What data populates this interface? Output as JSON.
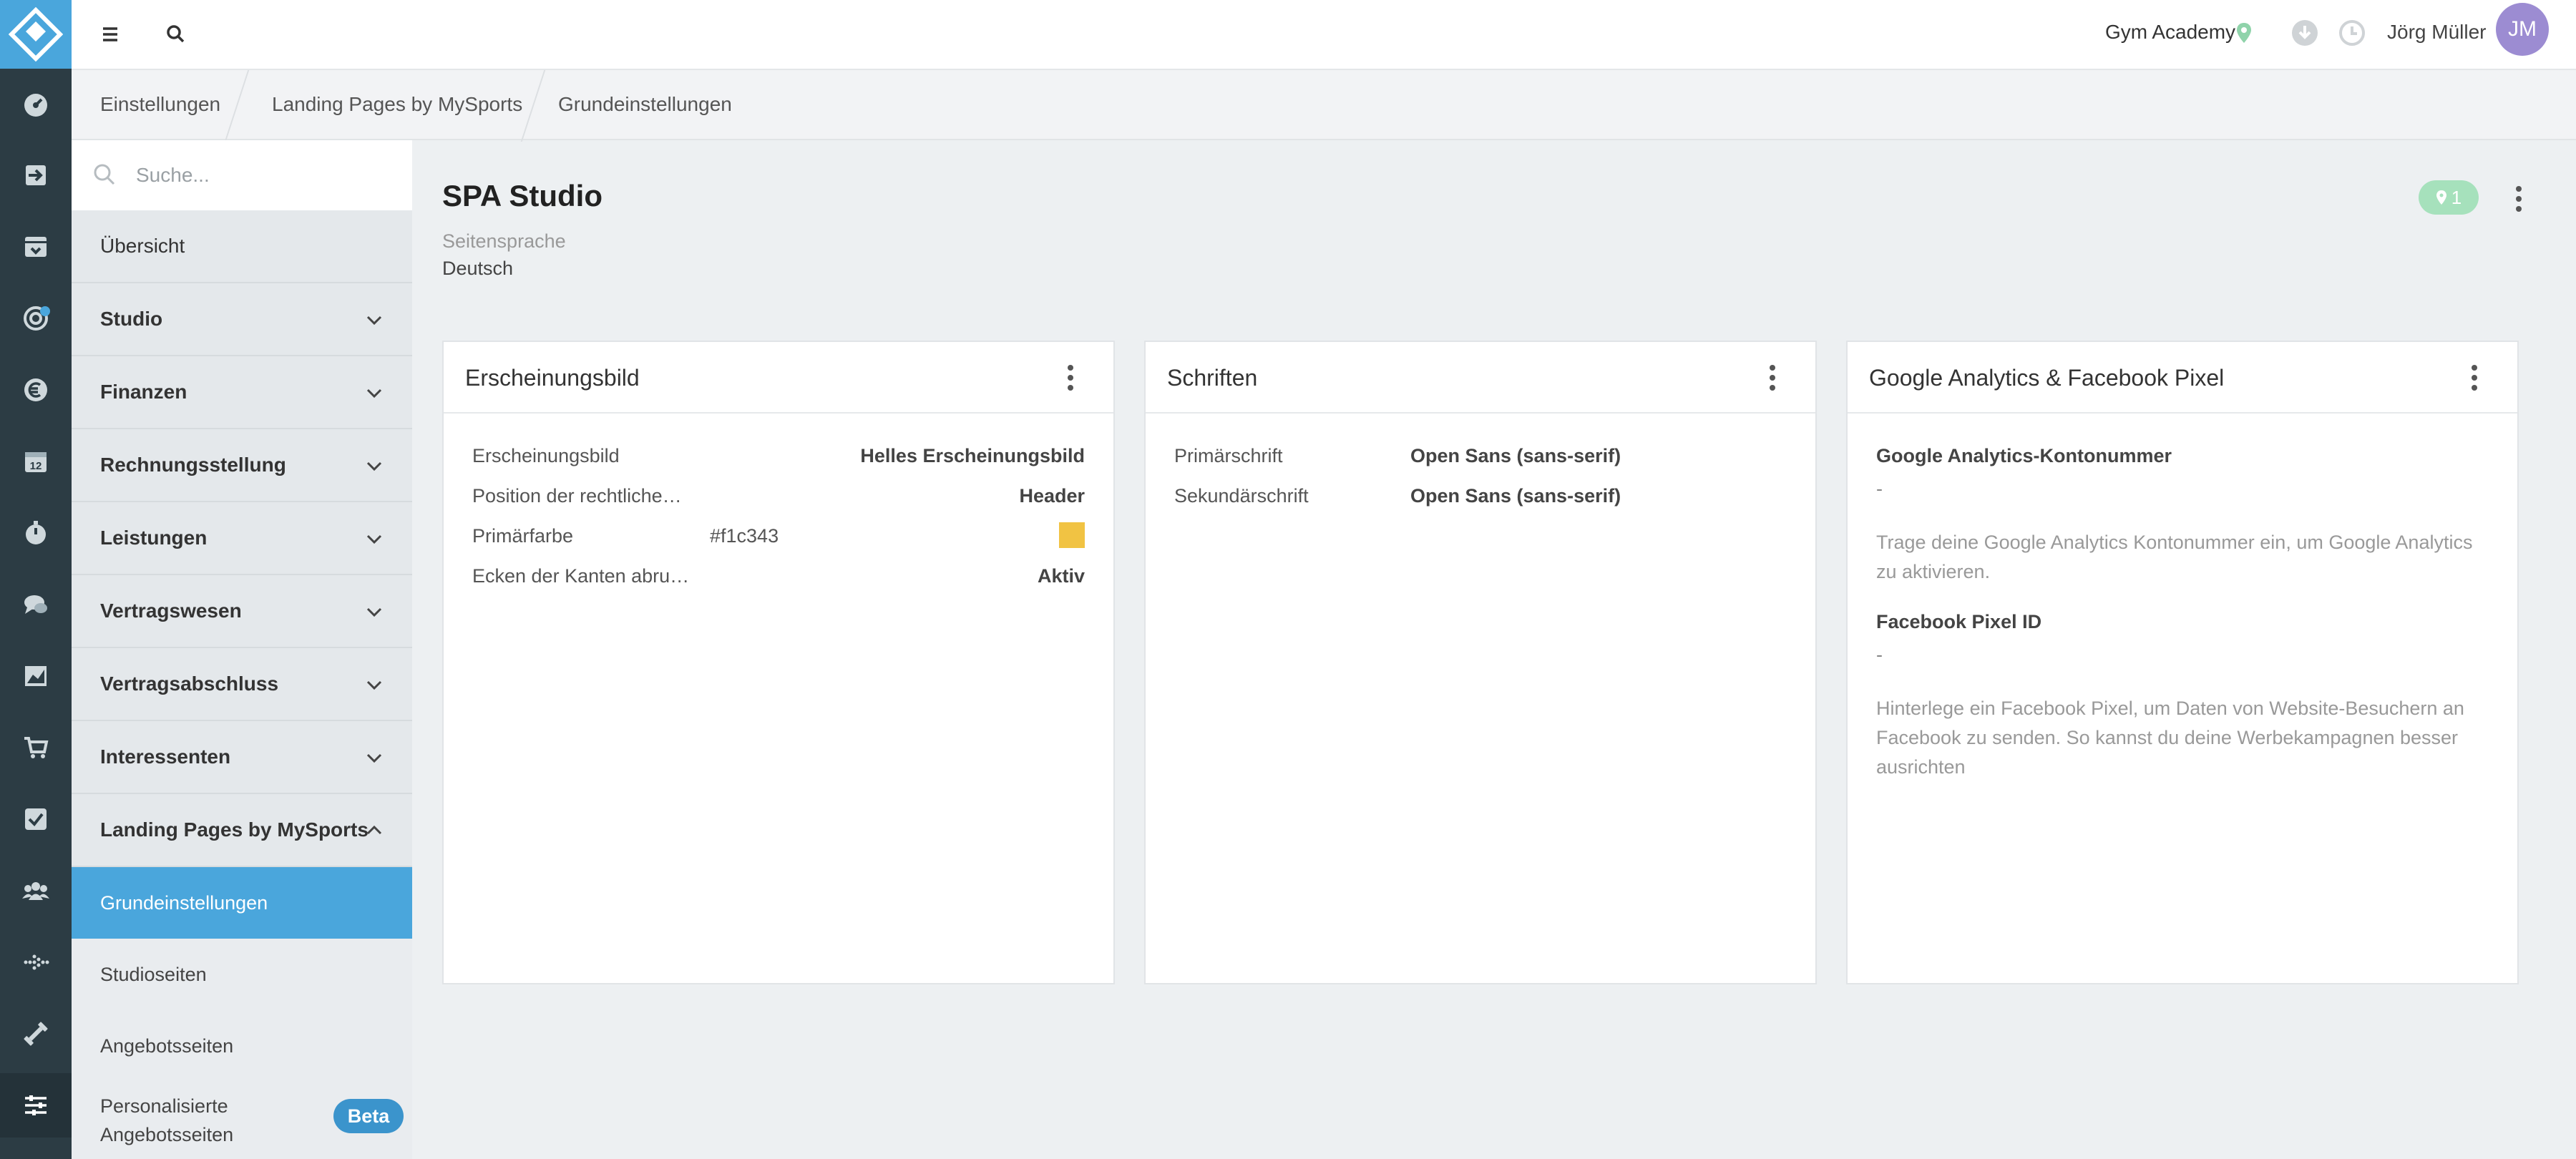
{
  "colors": {
    "rail_bg": "#2c3c44",
    "accent": "#4aa6dc",
    "primary_color_swatch": "#f1c343",
    "badge_green": "#a6e1bc",
    "avatar_bg": "#9c8cd2"
  },
  "topbar": {
    "menu_icon": "hamburger-icon",
    "search_icon": "search-icon",
    "org_name": "Gym Academy",
    "location_icon": "map-pin-icon",
    "download_icon": "download-icon",
    "history_icon": "clock-icon",
    "user_name": "Jörg Müller",
    "user_initials": "JM"
  },
  "rail": {
    "icons": [
      "dashboard-icon",
      "login-icon",
      "inbox-icon",
      "target-icon",
      "euro-icon",
      "calendar-icon",
      "timer-icon",
      "chat-icon",
      "chart-icon",
      "cart-icon",
      "checkbox-icon",
      "users-icon",
      "heartbeat-icon",
      "dumbbell-icon",
      "settings-sliders-icon"
    ],
    "calendar_day": "12"
  },
  "breadcrumb": [
    "Einstellungen",
    "Landing Pages by MySports",
    "Grundeinstellungen"
  ],
  "sidebar": {
    "search_placeholder": "Suche...",
    "overview": "Übersicht",
    "sections": [
      "Studio",
      "Finanzen",
      "Rechnungsstellung",
      "Leistungen",
      "Vertragswesen",
      "Vertragsabschluss",
      "Interessenten",
      "Landing Pages by MySports"
    ],
    "sub_items": [
      "Grundeinstellungen",
      "Studioseiten",
      "Angebotsseiten"
    ],
    "personalized_line1": "Personalisierte",
    "personalized_line2": "Angebotsseiten",
    "beta": "Beta"
  },
  "main": {
    "title": "SPA Studio",
    "language_label": "Seitensprache",
    "language_value": "Deutsch",
    "location_count": "1"
  },
  "appearance_card": {
    "title": "Erscheinungsbild",
    "rows": [
      {
        "label": "Erscheinungsbild",
        "value": "Helles Erscheinungsbild"
      },
      {
        "label": "Position der rechtliche…",
        "value": "Header"
      },
      {
        "label": "Primärfarbe",
        "value": "#f1c343"
      },
      {
        "label": "Ecken der Kanten abru…",
        "value": "Aktiv"
      }
    ]
  },
  "fonts_card": {
    "title": "Schriften",
    "rows": [
      {
        "label": "Primärschrift",
        "value": "Open Sans (sans-serif)"
      },
      {
        "label": "Sekundärschrift",
        "value": "Open Sans (sans-serif)"
      }
    ]
  },
  "analytics_card": {
    "title": "Google Analytics & Facebook Pixel",
    "ga_heading": "Google Analytics-Kontonummer",
    "ga_value": "-",
    "ga_help": "Trage deine Google Analytics Kontonummer ein, um Google Analytics zu aktivieren.",
    "fb_heading": "Facebook Pixel ID",
    "fb_value": "-",
    "fb_help": "Hinterlege ein Facebook Pixel, um Daten von Website-Besuchern an Facebook zu senden. So kannst du deine Werbekampagnen besser ausrichten"
  }
}
